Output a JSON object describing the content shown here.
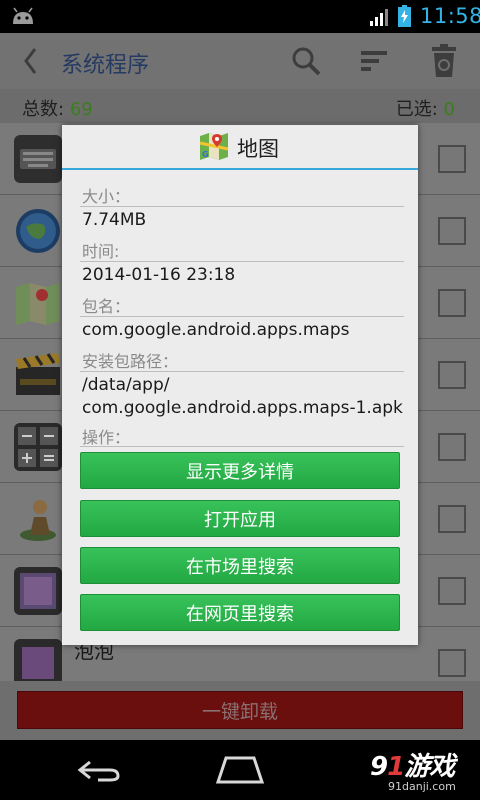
{
  "status_bar": {
    "time": "11:58",
    "icons": [
      "android-icon",
      "signal-icon",
      "battery-charging-icon"
    ],
    "clock_color": "#35b3e5"
  },
  "app": {
    "title": "系统程序",
    "count": {
      "total_label": "总数:",
      "total_value": "69",
      "selected_label": "已选:",
      "selected_value": "0"
    },
    "rows": [
      {
        "icon": "keyboard-icon"
      },
      {
        "icon": "google-earth-icon"
      },
      {
        "icon": "maps-icon"
      },
      {
        "icon": "clapperboard-icon"
      },
      {
        "icon": "calculator-icon"
      },
      {
        "icon": "latitude-person-icon"
      },
      {
        "icon": "gallery-icon"
      },
      {
        "icon": "app-icon",
        "label": "泡泡"
      }
    ],
    "uninstall_label": "一键卸载",
    "action_icons": [
      "back-chevron-icon",
      "search-icon",
      "sort-icon",
      "recycle-trash-icon"
    ]
  },
  "dialog": {
    "title": "地图",
    "fields": [
      {
        "label": "大小：",
        "value": "7.74MB"
      },
      {
        "label": "时间:",
        "value": "2014-01-16 23:18"
      },
      {
        "label": "包名：",
        "value": "com.google.android.apps.maps"
      },
      {
        "label": "安装包路径：",
        "value_line1": "/data/app/",
        "value_line2": "com.google.android.apps.maps-1.apk"
      },
      {
        "label": "操作："
      }
    ],
    "buttons": [
      "显示更多详情",
      "打开应用",
      "在市场里搜索",
      "在网页里搜索"
    ],
    "accent_color": "#37a8dc",
    "button_color": "#2cb34d"
  },
  "watermark": {
    "logo_prefix": "9",
    "logo_accent": "1",
    "logo_suffix": "游戏",
    "url": "91danji.com"
  }
}
